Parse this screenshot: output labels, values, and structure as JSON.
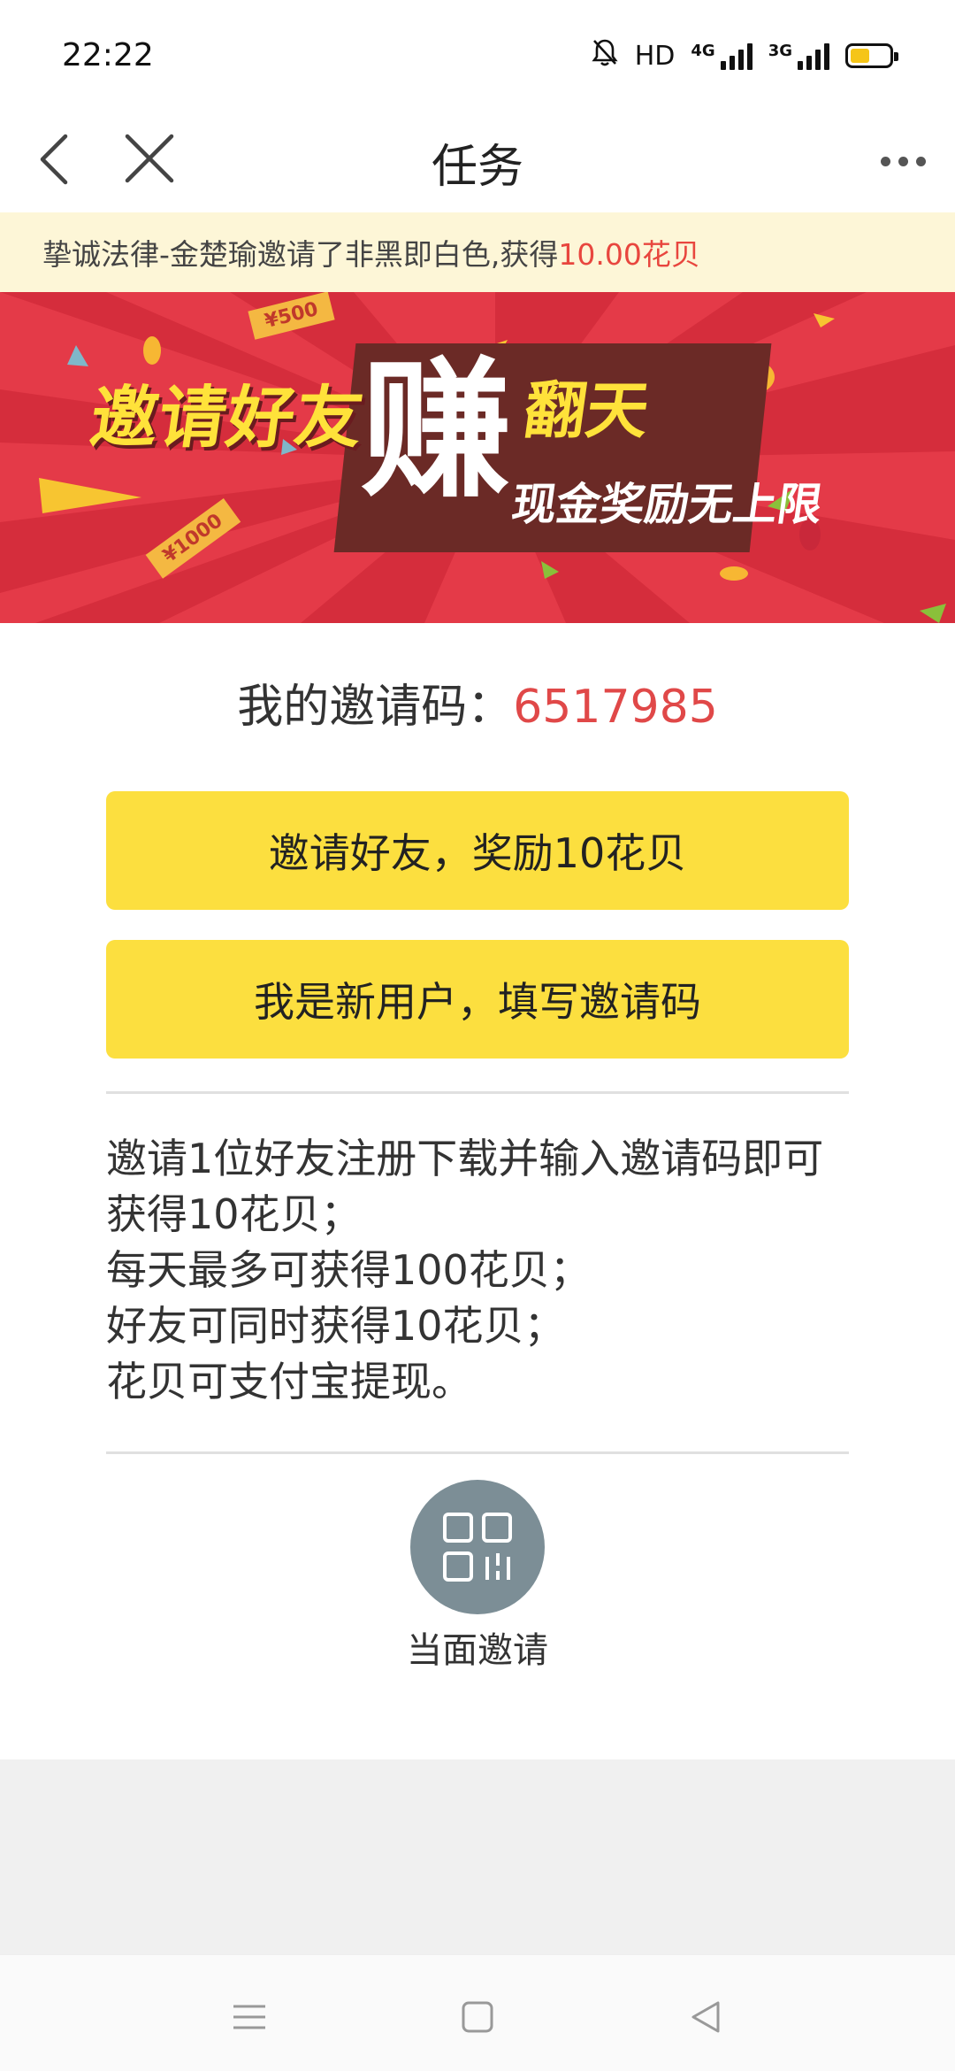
{
  "status_bar": {
    "time": "22:22",
    "hd_label": "HD",
    "net1_label": "4G",
    "net2_label": "3G",
    "battery_level": 0.5,
    "battery_color": "#f5c518"
  },
  "nav": {
    "title": "任务",
    "back_icon": "chevron-left-icon",
    "close_icon": "close-icon",
    "more_icon": "more-dots-icon"
  },
  "notice": {
    "text_prefix": "挚诚法律-金楚瑜邀请了非黑即白色,获得",
    "reward": "10.00花贝",
    "highlight_color": "#e8463e"
  },
  "banner": {
    "invite_text": "邀请好友",
    "earn_text": "赚",
    "flip_text": "翻天",
    "sub_text": "现金奖励无上限",
    "tag_500": "¥500",
    "tag_1000": "¥1000",
    "background_color": "#e43a48"
  },
  "invite_code": {
    "label": "我的邀请码：",
    "value": "6517985"
  },
  "buttons": {
    "invite_friends": "邀请好友，奖励10花贝",
    "new_user": "我是新用户，填写邀请码",
    "color": "#fcdf3f"
  },
  "rules": [
    "邀请1位好友注册下载并输入邀请码即可获得10花贝；",
    "每天最多可获得100花贝；",
    "好友可同时获得10花贝；",
    "花贝可支付宝提现。"
  ],
  "face_invite": {
    "label": "当面邀请",
    "icon": "qr-code-icon"
  },
  "system_nav": {
    "menu_icon": "menu-icon",
    "home_icon": "home-square-icon",
    "back_icon": "back-triangle-icon"
  }
}
